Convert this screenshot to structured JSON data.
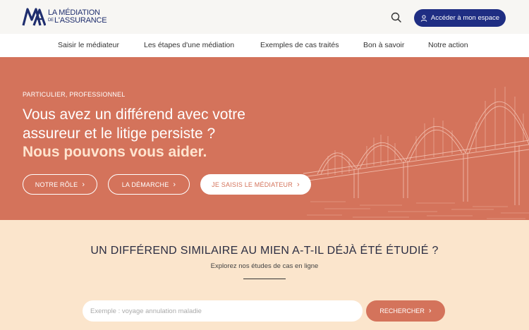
{
  "header": {
    "logo": {
      "line1": "LA MÉDIATION",
      "line2_prefix": "DE",
      "line2": "L'ASSURANCE"
    },
    "account_button": "Accéder à mon espace",
    "icons": {
      "search": "search-icon",
      "user": "user-icon"
    },
    "colors": {
      "brand": "#1f2e83",
      "header_bg": "#f7f6f3"
    }
  },
  "nav": {
    "items": [
      {
        "label": "Saisir le médiateur"
      },
      {
        "label": "Les étapes d'une médiation"
      },
      {
        "label": "Exemples de cas traités"
      },
      {
        "label": "Bon à savoir"
      },
      {
        "label": "Notre action"
      }
    ]
  },
  "hero": {
    "kicker": "PARTICULIER, PROFESSIONNEL",
    "title_line1": "Vous avez un différend avec votre",
    "title_line2": "assureur et le litige persiste ?",
    "accent": "Nous pouvons vous aider.",
    "buttons": [
      {
        "label": "NOTRE RÔLE"
      },
      {
        "label": "LA DÉMARCHE"
      },
      {
        "label": "JE SAISIS LE MÉDIATEUR"
      }
    ],
    "chevron": "›",
    "colors": {
      "bg": "#d4735b",
      "accent_text": "#ffe4cf"
    }
  },
  "cases": {
    "title": "UN DIFFÉREND SIMILAIRE AU MIEN A-T-IL DÉJÀ ÉTÉ ÉTUDIÉ ?",
    "subtitle": "Explorez nos études de cas en ligne",
    "search_placeholder": "Exemple : voyage annulation maladie",
    "search_value": "",
    "search_button": "RECHERCHER",
    "chevron": "›",
    "colors": {
      "bg": "#fbe5cc",
      "button": "#d4735b"
    }
  }
}
